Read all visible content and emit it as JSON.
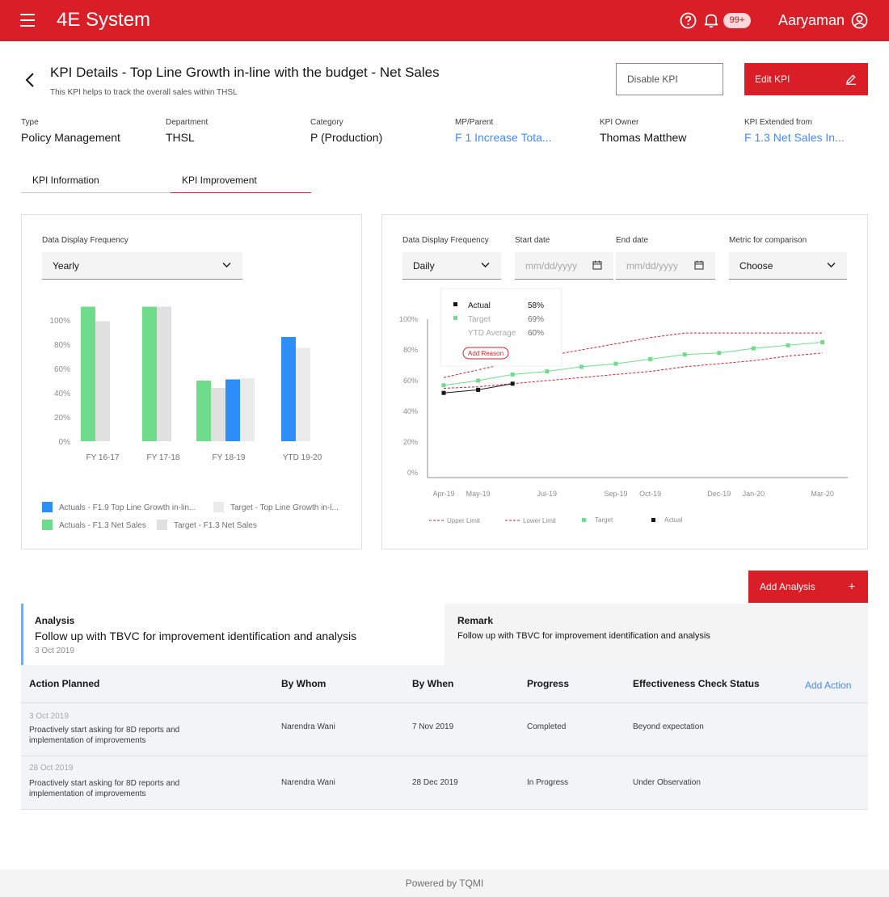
{
  "app": {
    "title": "4E System",
    "notification_count": "99+",
    "user_name": "Aaryaman"
  },
  "page": {
    "title": "KPI Details - Top Line Growth in-line with the budget - Net Sales",
    "subtitle": "This KPI helps to track the overall sales within THSL",
    "disable_label": "Disable KPI",
    "edit_label": "Edit KPI"
  },
  "meta": [
    {
      "label": "Type",
      "value": "Policy Management",
      "link": false
    },
    {
      "label": "Department",
      "value": "THSL",
      "link": false
    },
    {
      "label": "Category",
      "value": "P (Production)",
      "link": false
    },
    {
      "label": "MP/Parent",
      "value": "F 1 Increase Tota...",
      "link": true
    },
    {
      "label": "KPI Owner",
      "value": "Thomas Matthew",
      "link": false
    },
    {
      "label": "KPI Extended from",
      "value": "F 1.3 Net Sales In...",
      "link": true
    }
  ],
  "tabs": [
    {
      "label": "KPI Information"
    },
    {
      "label": "KPI Improvement"
    }
  ],
  "left_panel": {
    "freq_label": "Data Display Frequency",
    "freq_value": "Yearly",
    "legend": [
      "Actuals - F1.9 Top Line Growth in-lin...",
      "Target - Top Line Growth in-l...",
      "Actuals - F1.3 Net Sales",
      "Target - F1.3 Net Sales"
    ]
  },
  "right_panel": {
    "freq_label": "Data Display Frequency",
    "freq_value": "Daily",
    "start_label": "Start date",
    "end_label": "End date",
    "date_placeholder": "mm/dd/yyyy",
    "metric_label": "Metric for comparison",
    "metric_value": "Choose",
    "tooltip": {
      "rows": [
        {
          "label": "Actual",
          "value": "58%"
        },
        {
          "label": "Target",
          "value": "69%"
        },
        {
          "label": "YTD Average",
          "value": "60%"
        }
      ],
      "button": "Add Reason"
    },
    "legend": [
      "Upper Limit",
      "Lower Limit",
      "Target",
      "Actual"
    ]
  },
  "colors": {
    "brand": "#da1e28",
    "green": "#6fdc8c",
    "blue": "#2d8ef7",
    "grey": "#e0e0e0",
    "link": "#4589ff"
  },
  "chart_data": [
    {
      "type": "bar",
      "categories": [
        "FY 16-17",
        "FY 17-18",
        "FY 18-19",
        "YTD 19-20"
      ],
      "yticks": [
        "0%",
        "20%",
        "40%",
        "60%",
        "80%",
        "100%"
      ],
      "ylim": [
        0,
        100
      ],
      "series": [
        {
          "name": "Actuals - F1.3 Net Sales",
          "color": "#6fdc8c",
          "values": [
            111,
            111,
            50,
            null
          ]
        },
        {
          "name": "Target - F1.3 Net Sales",
          "color": "#e0e0e0",
          "values": [
            99,
            111,
            44,
            null
          ]
        },
        {
          "name": "Actuals - F1.9 Top Line Growth in-lin...",
          "color": "#2d8ef7",
          "values": [
            null,
            null,
            51,
            86
          ]
        },
        {
          "name": "Target - Top Line Growth in-l...",
          "color": "#ebebeb",
          "values": [
            null,
            null,
            52,
            77
          ]
        }
      ]
    },
    {
      "type": "line",
      "x": [
        "Apr-19",
        "May-19",
        "Jun-19",
        "Jul-19",
        "Aug-19",
        "Sep-19",
        "Oct-19",
        "Nov-19",
        "Dec-19",
        "Jan-20",
        "Feb-20",
        "Mar-20"
      ],
      "xticks": [
        "Apr-19",
        "May-19",
        "Jul-19",
        "Sep-19",
        "Oct-19",
        "Dec-19",
        "Jan-20",
        "Mar-20"
      ],
      "yticks": [
        "0%",
        "20%",
        "40%",
        "60%",
        "80%",
        "100%"
      ],
      "ylim": [
        0,
        100
      ],
      "series": [
        {
          "name": "Upper Limit",
          "style": "dashed",
          "color": "#da1e28",
          "values": [
            62,
            67,
            72,
            76,
            80,
            84,
            88,
            91,
            91,
            91,
            91,
            91
          ]
        },
        {
          "name": "Lower Limit",
          "style": "dashed",
          "color": "#da1e28",
          "values": [
            55,
            56,
            58,
            60,
            62,
            64,
            66,
            69,
            71,
            73,
            76,
            78
          ]
        },
        {
          "name": "Target",
          "style": "markers-line",
          "color": "#6fdc8c",
          "values": [
            57,
            60,
            64,
            66,
            69,
            71,
            74,
            77,
            78,
            81,
            83,
            85
          ]
        },
        {
          "name": "Actual",
          "style": "markers-line",
          "color": "#161616",
          "values": [
            52,
            54,
            58,
            null,
            null,
            null,
            null,
            null,
            null,
            null,
            null,
            null
          ]
        }
      ]
    }
  ],
  "analysis": {
    "add_label": "Add Analysis",
    "analysis_title": "Analysis",
    "analysis_text": "Follow up with TBVC for improvement identification and analysis",
    "analysis_date": "3 Oct 2019",
    "remark_title": "Remark",
    "remark_text": "Follow up with TBVC for improvement identification and analysis"
  },
  "table": {
    "headers": [
      "Action Planned",
      "By Whom",
      "By When",
      "Progress",
      "Effectiveness Check Status"
    ],
    "add_action": "Add Action",
    "rows": [
      {
        "date": "3 Oct 2019",
        "line1": "Proactively start asking for 8D reports and",
        "line2": "implementation of improvements",
        "by_whom": "Narendra Wani",
        "by_when": "7 Nov 2019",
        "progress": "Completed",
        "status": "Beyond expectation"
      },
      {
        "date": "28 Oct 2019",
        "line1": "Proactively start asking for 8D reports and",
        "line2": "implementation of improvements",
        "by_whom": "Narendra Wani",
        "by_when": "28 Dec 2019",
        "progress": "In Progress",
        "status": "Under Observation"
      }
    ]
  },
  "footer": {
    "text": "Powered by TQMI"
  }
}
